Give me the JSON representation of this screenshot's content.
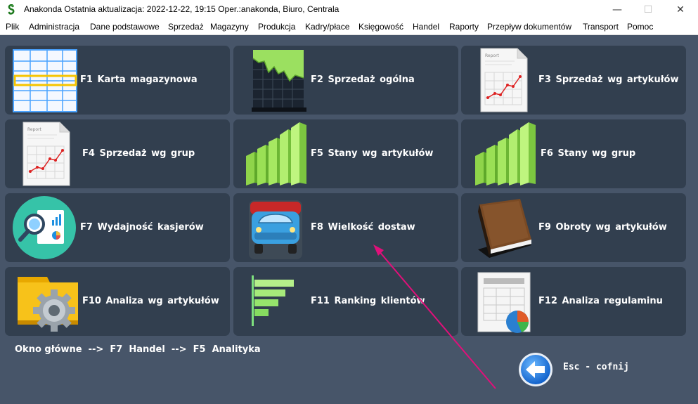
{
  "window": {
    "title": "Anakonda Ostatnia aktualizacja: 2022-12-22, 19:15 Oper.:anakonda, Biuro, Centrala",
    "minimize_glyph": "—",
    "maximize_glyph": "☐",
    "close_glyph": "✕"
  },
  "menu": [
    "Plik",
    "Administracja",
    "Dane podstawowe",
    "Sprzedaż",
    "Magazyny",
    "Produkcja",
    "Kadry/płace",
    "Księgowość",
    "Handel",
    "Raporty",
    "Przepływ dokumentów",
    "Transport",
    "Pomoc"
  ],
  "tiles": [
    {
      "label": "F1  Karta magazynowa",
      "icon": "spreadsheet-icon"
    },
    {
      "label": "F2  Sprzedaż ogólna",
      "icon": "area-chart-icon"
    },
    {
      "label": "F3  Sprzedaż wg artykułów",
      "icon": "report-document-icon"
    },
    {
      "label": "F4  Sprzedaż wg grup",
      "icon": "report-document-icon"
    },
    {
      "label": "F5  Stany wg artykułów",
      "icon": "green-bars-icon"
    },
    {
      "label": "F6  Stany wg grup",
      "icon": "green-bars-icon"
    },
    {
      "label": "F7  Wydajność kasjerów",
      "icon": "magnifier-analytics-icon"
    },
    {
      "label": "F8  Wielkość dostaw",
      "icon": "truck-icon"
    },
    {
      "label": "F9  Obroty wg artykułów",
      "icon": "book-icon"
    },
    {
      "label": "F10  Analiza wg artykułów",
      "icon": "gear-folder-icon"
    },
    {
      "label": "F11  Ranking klientów",
      "icon": "bar-ranking-icon"
    },
    {
      "label": "F12  Analiza regulaminu",
      "icon": "spreadsheet-pie-icon"
    }
  ],
  "breadcrumb": "Okno główne  -->  F7  Handel  -->  F5  Analityka",
  "back": {
    "label": "Esc - cofnij",
    "icon": "back-arrow-icon"
  },
  "colors": {
    "background": "#475569",
    "tile": "#323f4f",
    "annotation_arrow": "#e0107a"
  }
}
